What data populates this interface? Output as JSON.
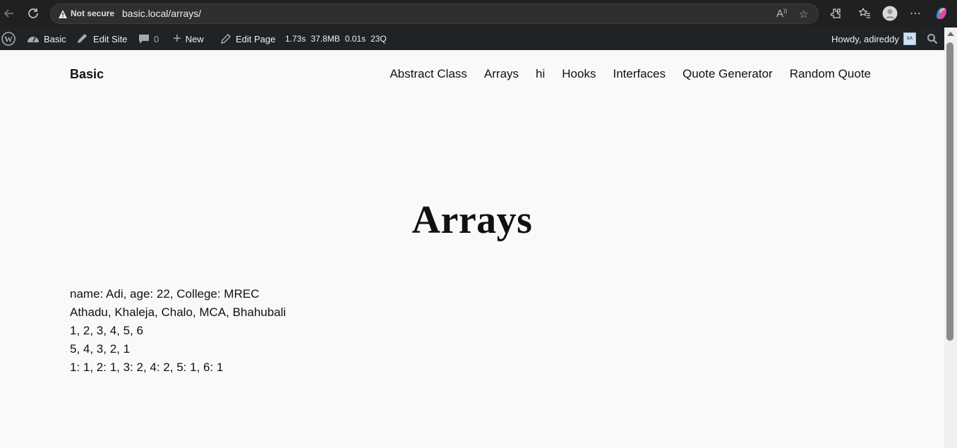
{
  "browser": {
    "security_label": "Not secure",
    "url": "basic.local/arrays/"
  },
  "adminbar": {
    "site_name": "Basic",
    "edit_site": "Edit Site",
    "comments_count": "0",
    "new_label": "New",
    "edit_page": "Edit Page",
    "stats": {
      "time": "1.73s",
      "memory": "37.8MB",
      "query_time": "0.01s",
      "queries": "23Q"
    },
    "howdy": "Howdy, adireddy",
    "avatar_initials": "SA"
  },
  "site": {
    "title": "Basic",
    "menu": [
      "Abstract Class",
      "Arrays",
      "hi",
      "Hooks",
      "Interfaces",
      "Quote Generator",
      "Random Quote"
    ]
  },
  "page": {
    "title": "Arrays",
    "lines": [
      "name: Adi, age: 22, College: MREC",
      "Athadu, Khaleja, Chalo, MCA, Bhahubali",
      "1, 2, 3, 4, 5, 6",
      "5, 4, 3, 2, 1",
      "1: 1, 2: 1, 3: 2, 4: 2, 5: 1, 6: 1"
    ]
  }
}
